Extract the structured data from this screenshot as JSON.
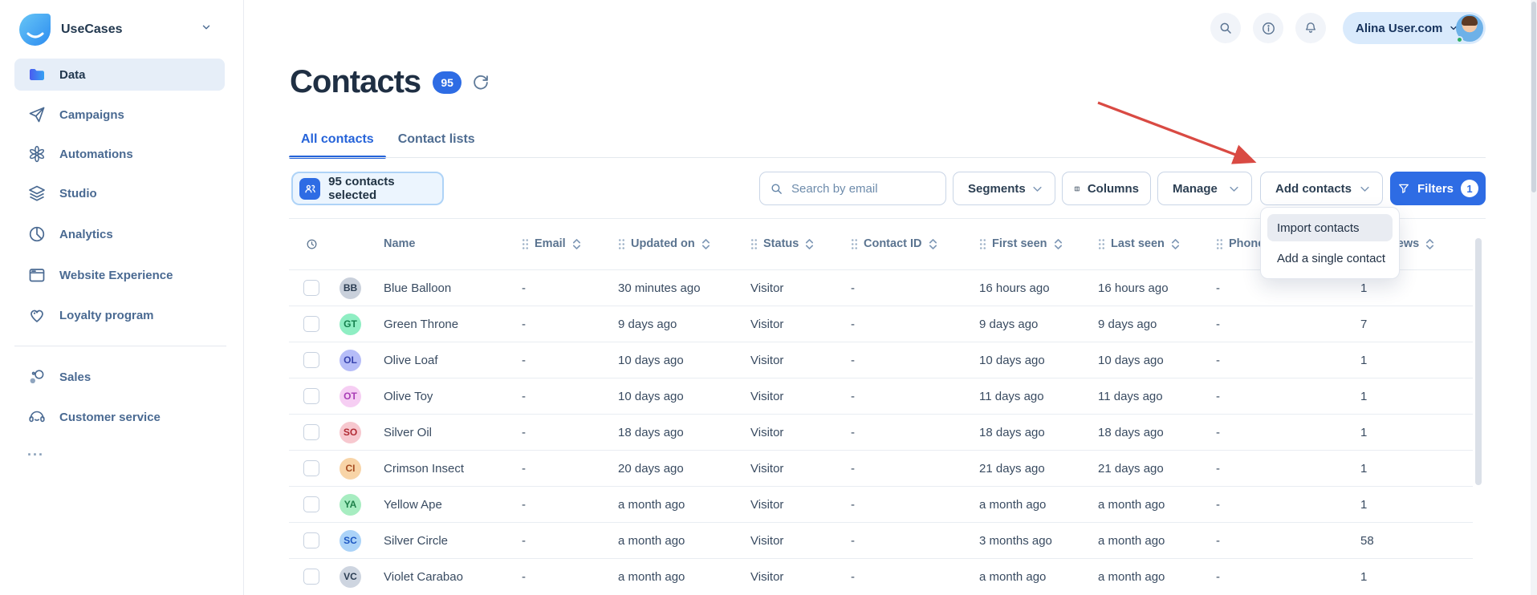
{
  "app": {
    "name": "UseCases"
  },
  "sidebar": {
    "logo_label": "UseCases",
    "items": [
      {
        "label": "Data",
        "icon": "folder-icon",
        "active": true
      },
      {
        "label": "Campaigns",
        "icon": "paper-plane-icon",
        "active": false
      },
      {
        "label": "Automations",
        "icon": "flower-icon",
        "active": false
      },
      {
        "label": "Studio",
        "icon": "layers-icon",
        "active": false
      },
      {
        "label": "Analytics",
        "icon": "pie-chart-icon",
        "active": false
      },
      {
        "label": "Website Experience",
        "icon": "browser-icon",
        "active": false
      },
      {
        "label": "Loyalty program",
        "icon": "heart-icon",
        "active": false
      }
    ],
    "secondary_items": [
      {
        "label": "Sales",
        "icon": "sales-icon"
      },
      {
        "label": "Customer service",
        "icon": "headset-icon"
      }
    ],
    "more_label": "..."
  },
  "topbar": {
    "icons": [
      "search-icon",
      "info-icon",
      "bell-icon"
    ],
    "user": {
      "name": "Alina User.com",
      "status": "online"
    }
  },
  "header": {
    "title": "Contacts",
    "count": "95"
  },
  "tabs": [
    {
      "label": "All contacts",
      "active": true
    },
    {
      "label": "Contact lists",
      "active": false
    }
  ],
  "toolbar": {
    "selected_button": {
      "label": "95 contacts selected",
      "icon": "people-icon"
    },
    "search": {
      "placeholder": "Search by email",
      "icon": "search-icon"
    },
    "segments_button": {
      "label": "Segments"
    },
    "columns_button": {
      "label": "Columns",
      "icon": "columns-icon"
    },
    "manage_button": {
      "label": "Manage"
    },
    "add_contacts_button": {
      "label": "Add contacts"
    },
    "filters_button": {
      "label": "Filters",
      "badge": "1",
      "icon": "funnel-icon"
    }
  },
  "add_contacts_menu": {
    "items": [
      {
        "label": "Import contacts",
        "highlighted": true
      },
      {
        "label": "Add a single contact",
        "highlighted": false
      }
    ]
  },
  "table": {
    "columns": [
      {
        "label": "",
        "icon": "clock-icon"
      },
      {
        "label": "Name"
      },
      {
        "label": "Email",
        "sortable": true
      },
      {
        "label": "Updated on",
        "sortable": true
      },
      {
        "label": "Status",
        "sortable": true
      },
      {
        "label": "Contact ID",
        "sortable": true
      },
      {
        "label": "First seen",
        "sortable": true
      },
      {
        "label": "Last seen",
        "sortable": true
      },
      {
        "label": "Phone",
        "sortable": true
      },
      {
        "label": "Page views",
        "sortable": true
      }
    ],
    "rows": [
      {
        "initials": "BB",
        "name": "Blue Balloon",
        "email": "-",
        "updated_on": "30 minutes ago",
        "status": "Visitor",
        "contact_id": "-",
        "first_seen": "16 hours ago",
        "last_seen": "16 hours ago",
        "phone": "-",
        "page_views": "1",
        "avatar_bg": "#c9d0db",
        "avatar_fg": "#2c3e53"
      },
      {
        "initials": "GT",
        "name": "Green Throne",
        "email": "-",
        "updated_on": "9 days ago",
        "status": "Visitor",
        "contact_id": "-",
        "first_seen": "9 days ago",
        "last_seen": "9 days ago",
        "phone": "-",
        "page_views": "7",
        "avatar_bg": "#8feec3",
        "avatar_fg": "#15804e"
      },
      {
        "initials": "OL",
        "name": "Olive Loaf",
        "email": "-",
        "updated_on": "10 days ago",
        "status": "Visitor",
        "contact_id": "-",
        "first_seen": "10 days ago",
        "last_seen": "10 days ago",
        "phone": "-",
        "page_views": "1",
        "avatar_bg": "#b6bdf8",
        "avatar_fg": "#3743ae"
      },
      {
        "initials": "OT",
        "name": "Olive Toy",
        "email": "-",
        "updated_on": "10 days ago",
        "status": "Visitor",
        "contact_id": "-",
        "first_seen": "11 days ago",
        "last_seen": "11 days ago",
        "phone": "-",
        "page_views": "1",
        "avatar_bg": "#f6cef3",
        "avatar_fg": "#a83cb5"
      },
      {
        "initials": "SO",
        "name": "Silver Oil",
        "email": "-",
        "updated_on": "18 days ago",
        "status": "Visitor",
        "contact_id": "-",
        "first_seen": "18 days ago",
        "last_seen": "18 days ago",
        "phone": "-",
        "page_views": "1",
        "avatar_bg": "#f7c8cf",
        "avatar_fg": "#b12b34"
      },
      {
        "initials": "CI",
        "name": "Crimson Insect",
        "email": "-",
        "updated_on": "20 days ago",
        "status": "Visitor",
        "contact_id": "-",
        "first_seen": "21 days ago",
        "last_seen": "21 days ago",
        "phone": "-",
        "page_views": "1",
        "avatar_bg": "#f8d4a7",
        "avatar_fg": "#a64b21"
      },
      {
        "initials": "YA",
        "name": "Yellow Ape",
        "email": "-",
        "updated_on": "a month ago",
        "status": "Visitor",
        "contact_id": "-",
        "first_seen": "a month ago",
        "last_seen": "a month ago",
        "phone": "-",
        "page_views": "1",
        "avatar_bg": "#a7edc1",
        "avatar_fg": "#1e8049"
      },
      {
        "initials": "SC",
        "name": "Silver Circle",
        "email": "-",
        "updated_on": "a month ago",
        "status": "Visitor",
        "contact_id": "-",
        "first_seen": "3 months ago",
        "last_seen": "a month ago",
        "phone": "-",
        "page_views": "58",
        "avatar_bg": "#abd3f8",
        "avatar_fg": "#1c57c2"
      },
      {
        "initials": "VC",
        "name": "Violet Carabao",
        "email": "-",
        "updated_on": "a month ago",
        "status": "Visitor",
        "contact_id": "-",
        "first_seen": "a month ago",
        "last_seen": "a month ago",
        "phone": "-",
        "page_views": "1",
        "avatar_bg": "#ced5e0",
        "avatar_fg": "#2c3e53"
      }
    ]
  },
  "colors": {
    "accent_blue": "#2e6ce4",
    "tab_blue": "#2563d9",
    "title_navy": "#1f2f43",
    "sidebar_text": "#4a6a92",
    "header_text": "#5b7490",
    "row_text": "#394b61",
    "selected_bg": "#ecf5fe",
    "selected_border": "#aed3f7",
    "arrow_red": "#d94a43"
  }
}
